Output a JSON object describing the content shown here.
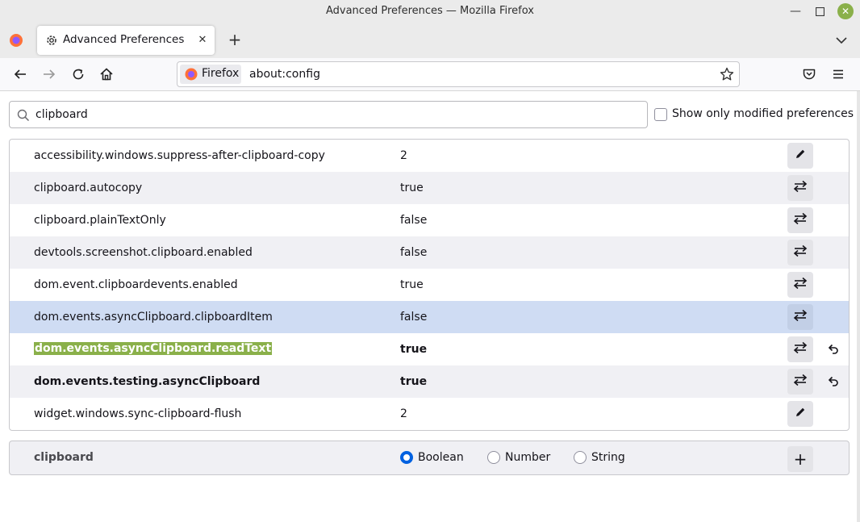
{
  "window": {
    "title": "Advanced Preferences — Mozilla Firefox",
    "accent_color": "#8ab04a"
  },
  "tabs": [
    {
      "label": "Advanced Preferences",
      "icon": "gear-icon",
      "active": true
    }
  ],
  "navbar": {
    "identity_label": "Firefox",
    "url": "about:config"
  },
  "search": {
    "value": "clipboard",
    "show_modified_label": "Show only modified preferences",
    "show_modified_checked": false
  },
  "prefs": [
    {
      "name": "accessibility.windows.suppress-after-clipboard-copy",
      "value": "2",
      "action": "edit-icon",
      "modified": false
    },
    {
      "name": "clipboard.autocopy",
      "value": "true",
      "action": "toggle-icon",
      "modified": false
    },
    {
      "name": "clipboard.plainTextOnly",
      "value": "false",
      "action": "toggle-icon",
      "modified": false
    },
    {
      "name": "devtools.screenshot.clipboard.enabled",
      "value": "false",
      "action": "toggle-icon",
      "modified": false
    },
    {
      "name": "dom.event.clipboardevents.enabled",
      "value": "true",
      "action": "toggle-icon",
      "modified": false
    },
    {
      "name": "dom.events.asyncClipboard.clipboardItem",
      "value": "false",
      "action": "toggle-icon",
      "modified": false,
      "selected": true
    },
    {
      "name": "dom.events.asyncClipboard.readText",
      "value": "true",
      "action": "toggle-icon",
      "modified": true,
      "highlighted": true
    },
    {
      "name": "dom.events.testing.asyncClipboard",
      "value": "true",
      "action": "toggle-icon",
      "modified": true
    },
    {
      "name": "widget.windows.sync-clipboard-flush",
      "value": "2",
      "action": "edit-icon",
      "modified": false
    }
  ],
  "new_pref": {
    "name": "clipboard",
    "types": [
      "Boolean",
      "Number",
      "String"
    ],
    "selected_type": "Boolean",
    "add_label": "+"
  }
}
